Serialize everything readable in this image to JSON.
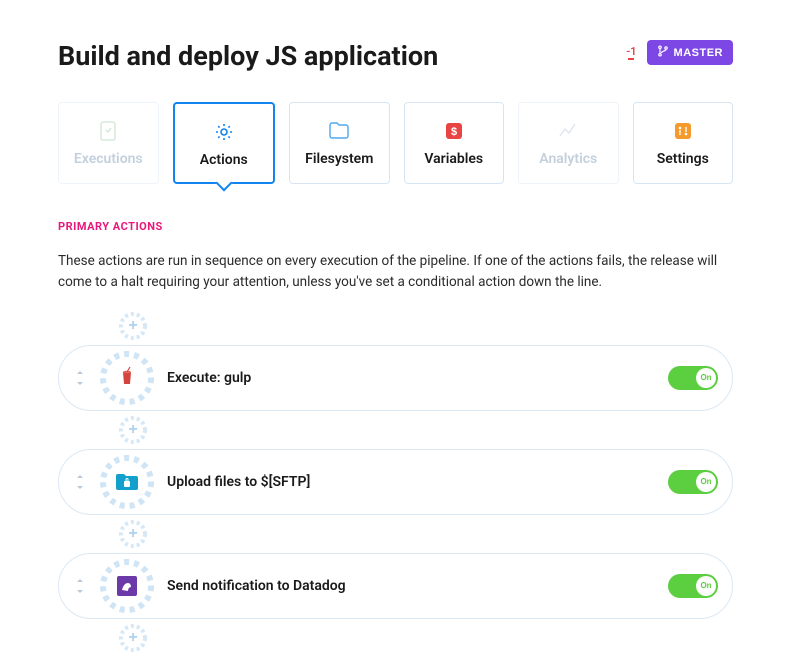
{
  "header": {
    "title": "Build and deploy JS application",
    "indicator": "-1",
    "master_label": "MASTER"
  },
  "tabs": [
    {
      "label": "Executions"
    },
    {
      "label": "Actions"
    },
    {
      "label": "Filesystem"
    },
    {
      "label": "Variables"
    },
    {
      "label": "Analytics"
    },
    {
      "label": "Settings"
    }
  ],
  "section": {
    "label": "PRIMARY ACTIONS",
    "desc": "These actions are run in sequence on every execution of the pipeline. If one of the actions fails, the release will come to a halt requiring your attention, unless you've set a conditional action down the line."
  },
  "actions": [
    {
      "label": "Execute: gulp",
      "toggle": "On"
    },
    {
      "label": "Upload files to $[SFTP]",
      "toggle": "On"
    },
    {
      "label": "Send notification to Datadog",
      "toggle": "On"
    }
  ]
}
